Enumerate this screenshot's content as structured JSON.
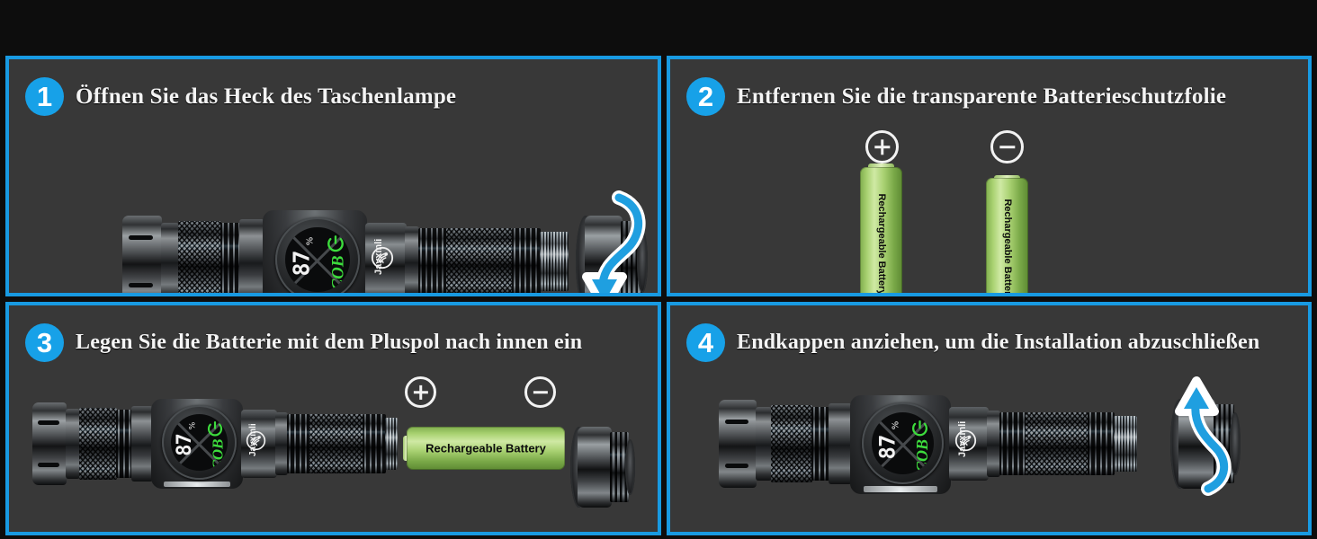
{
  "page": {
    "background_color": "#0d0d0d",
    "panel_color": "#383838",
    "accent_color": "#189ae2",
    "text_color": "#f4f4f4",
    "led_green": "#3ddc3d",
    "battery_green": "#a8d170"
  },
  "panels": [
    {
      "number": "1",
      "title": "Öffnen Sie das Heck des Taschenlampe",
      "arrow_direction": "down",
      "flashlight": {
        "battery_percent": "87",
        "percent_symbol": "%",
        "mode_label": "COB",
        "brand": "Jayxinli",
        "power_icon": "power-icon"
      }
    },
    {
      "number": "2",
      "title": "Entfernen Sie die transparente Batterieschutzfolie",
      "batteries": [
        {
          "label": "Rechargeable Battery",
          "polarity": "plus",
          "polarity_symbol": "⊕"
        },
        {
          "label": "Rechargeable Battery",
          "polarity": "minus",
          "polarity_symbol": "⊖"
        }
      ]
    },
    {
      "number": "3",
      "title": "Legen Sie die Batterie mit dem Pluspol nach innen ein",
      "flashlight": {
        "battery_percent": "87",
        "percent_symbol": "%",
        "mode_label": "COB",
        "brand": "Jayxinli",
        "power_icon": "power-icon"
      },
      "battery": {
        "label": "Rechargeable Battery"
      },
      "polarity_plus": "⊕",
      "polarity_minus": "⊖"
    },
    {
      "number": "4",
      "title": "Endkappen anziehen, um die Installation abzuschließen",
      "arrow_direction": "up",
      "flashlight": {
        "battery_percent": "87",
        "percent_symbol": "%",
        "mode_label": "COB",
        "brand": "Jayxinli",
        "power_icon": "power-icon"
      }
    }
  ]
}
